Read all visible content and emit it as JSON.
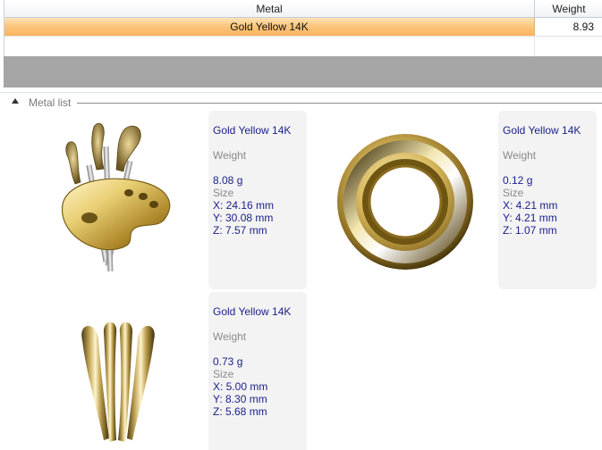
{
  "grid": {
    "columns": {
      "metal": "Metal",
      "weight": "Weight"
    },
    "rows": [
      {
        "metal": "Gold Yellow 14K",
        "weight": "8.93"
      }
    ]
  },
  "group": {
    "title": "Metal list"
  },
  "labels": {
    "weight": "Weight",
    "size": "Size"
  },
  "items": [
    {
      "metal": "Gold Yellow 14K",
      "weight": "8.08 g",
      "x": "X: 24.16 mm",
      "y": "Y: 30.08 mm",
      "z": "Z: 7.57 mm",
      "icon": "palette-pendant-icon"
    },
    {
      "metal": "Gold Yellow 14K",
      "weight": "0.12 g",
      "x": "X: 4.21 mm",
      "y": "Y: 4.21 mm",
      "z": "Z: 1.07 mm",
      "icon": "ring-icon"
    },
    {
      "metal": "Gold Yellow 14K",
      "weight": "0.73 g",
      "x": "X: 5.00 mm",
      "y": "Y: 8.30 mm",
      "z": "Z: 5.68 mm",
      "icon": "bail-icon"
    }
  ],
  "colors": {
    "selection": "#f9b45e",
    "band": "#a5a5a5",
    "value_text": "#1a1f8a",
    "gold": "#c9a94a"
  }
}
